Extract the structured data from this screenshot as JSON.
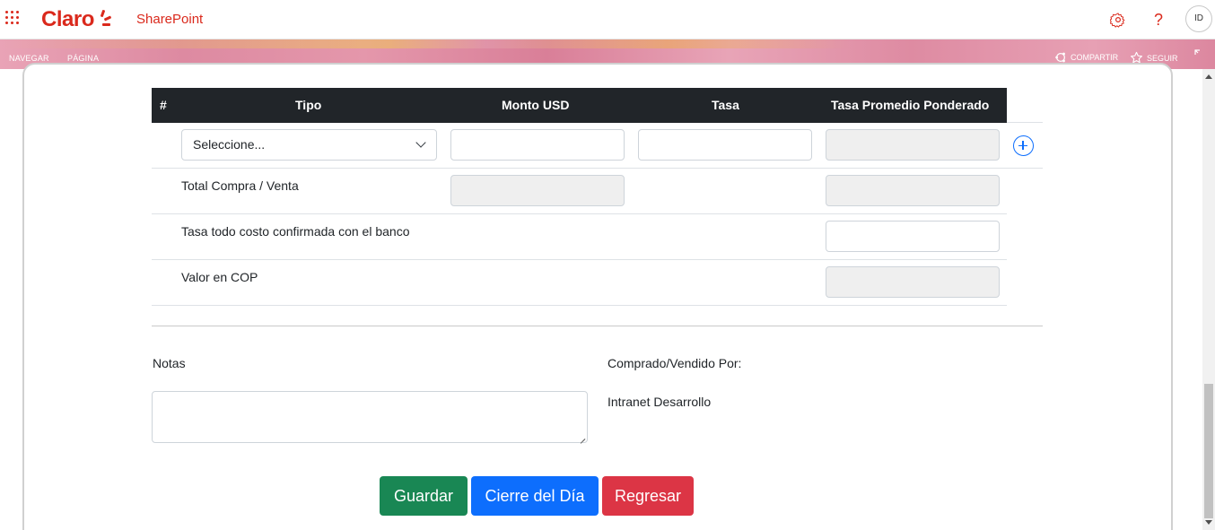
{
  "suite_bar": {
    "brand": "Claro",
    "app_name": "SharePoint",
    "avatar_initials": "ID",
    "brand_color": "#da291c",
    "icons": [
      "waffle-icon",
      "gear-icon",
      "help-icon"
    ]
  },
  "ribbon": {
    "left_items": [
      "NAVEGAR",
      "PÁGINA"
    ],
    "share_label": "COMPARTIR",
    "follow_label": "SEGUIR",
    "icons": [
      "share-icon",
      "star-icon",
      "focus-icon"
    ]
  },
  "table": {
    "headers": [
      "#",
      "Tipo",
      "Monto USD",
      "Tasa",
      "Tasa Promedio Ponderado"
    ],
    "row1": {
      "tipo_selected": "Seleccione...",
      "monto_usd": "",
      "tasa": "",
      "tasa_promedio": ""
    },
    "labels": {
      "total": "Total Compra / Venta",
      "tasa_todo_costo": "Tasa todo costo confirmada con el banco",
      "valor_cop": "Valor en COP"
    },
    "values": {
      "total_monto": "",
      "total_tasa_promedio": "",
      "tasa_todo_costo": "",
      "valor_cop": ""
    }
  },
  "notes": {
    "label": "Notas",
    "value": ""
  },
  "buyer": {
    "label": "Comprado/Vendido Por:",
    "value": "Intranet Desarrollo"
  },
  "buttons": {
    "save": "Guardar",
    "close_day": "Cierre del Día",
    "back": "Regresar"
  },
  "colors": {
    "header_dark": "#212529",
    "save_green": "#198754",
    "primary_blue": "#0d6efd",
    "danger_red": "#dc3545"
  }
}
